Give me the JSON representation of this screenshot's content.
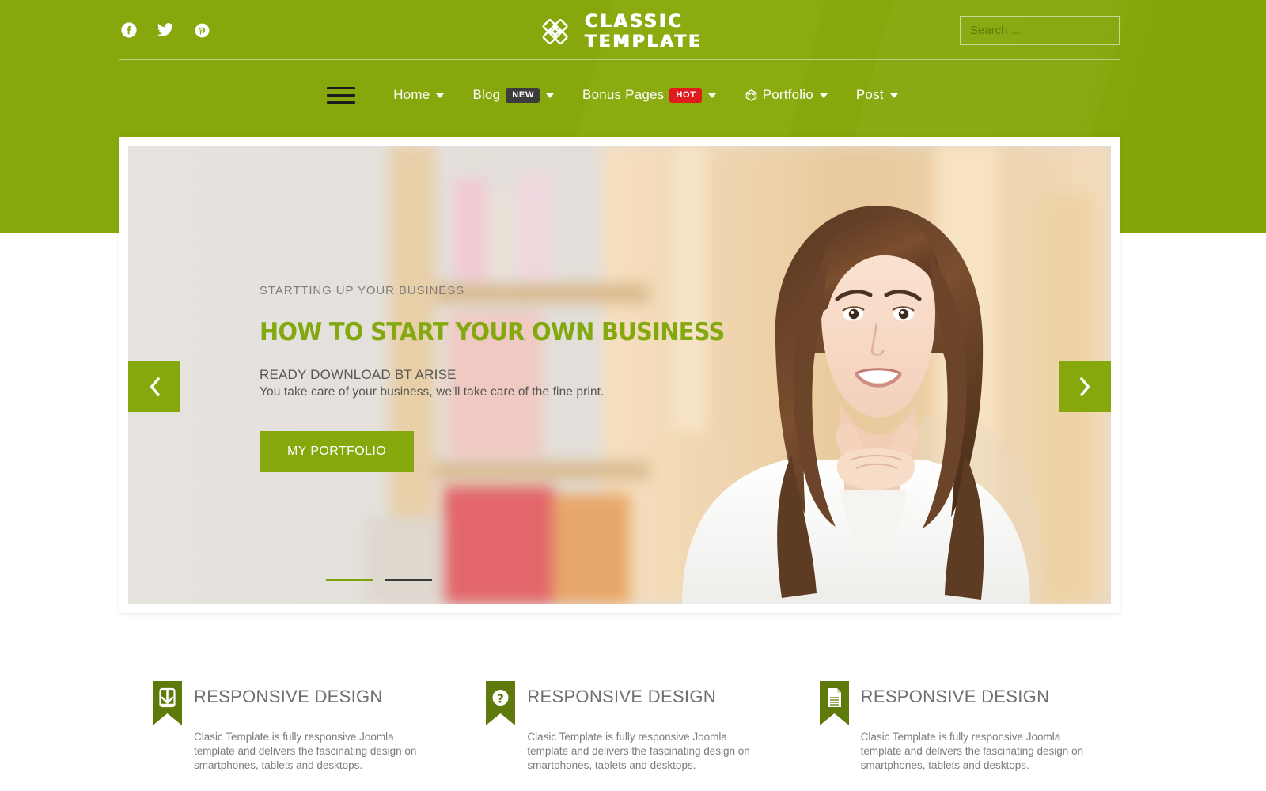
{
  "header": {
    "brand": {
      "line1": "CLASSIC",
      "line2": "TEMPLATE",
      "icon": "knot-logo-icon"
    },
    "social": [
      {
        "name": "facebook-icon",
        "label": "Facebook"
      },
      {
        "name": "twitter-icon",
        "label": "Twitter"
      },
      {
        "name": "pinterest-icon",
        "label": "Pinterest"
      }
    ],
    "search": {
      "placeholder": "Search ...",
      "value": ""
    },
    "accent_color": "#82a70b",
    "badge_new_color": "#3c3c3c",
    "badge_hot_color": "#e01b1b"
  },
  "nav": {
    "toggle_icon": "hamburger-menu-icon",
    "items": [
      {
        "label": "Home",
        "badge": "",
        "icon": "",
        "caret": true
      },
      {
        "label": "Blog",
        "badge": "NEW",
        "icon": "",
        "caret": true
      },
      {
        "label": "Bonus Pages",
        "badge": "HOT",
        "icon": "",
        "caret": true
      },
      {
        "label": "Portfolio",
        "badge": "",
        "icon": "cube-icon",
        "caret": true
      },
      {
        "label": "Post",
        "badge": "",
        "icon": "",
        "caret": true
      }
    ]
  },
  "slider": {
    "eyebrow": "STARTTING UP YOUR BUSINESS",
    "title": "HOW TO START YOUR OWN BUSINESS",
    "subtitle1": "READY DOWNLOAD BT ARISE",
    "subtitle2": "You take care of your business, we'll take care of the fine print.",
    "cta_label": "MY PORTFOLIO",
    "prev_icon": "chevron-left-icon",
    "next_icon": "chevron-right-icon",
    "slides_total": 2,
    "active_slide": 1,
    "title_color": "#84a910"
  },
  "features": [
    {
      "icon": "download-icon",
      "title": "RESPONSIVE DESIGN",
      "text": "Clasic Template is fully responsive Joomla template and delivers the fascinating design on smartphones, tablets and desktops."
    },
    {
      "icon": "question-mark-icon",
      "title": "RESPONSIVE DESIGN",
      "text": "Clasic Template is fully responsive Joomla template and delivers the fascinating design on smartphones, tablets and desktops."
    },
    {
      "icon": "document-icon",
      "title": "RESPONSIVE DESIGN",
      "text": "Clasic Template is fully responsive Joomla template and delivers the fascinating design on smartphones, tablets and desktops."
    }
  ]
}
